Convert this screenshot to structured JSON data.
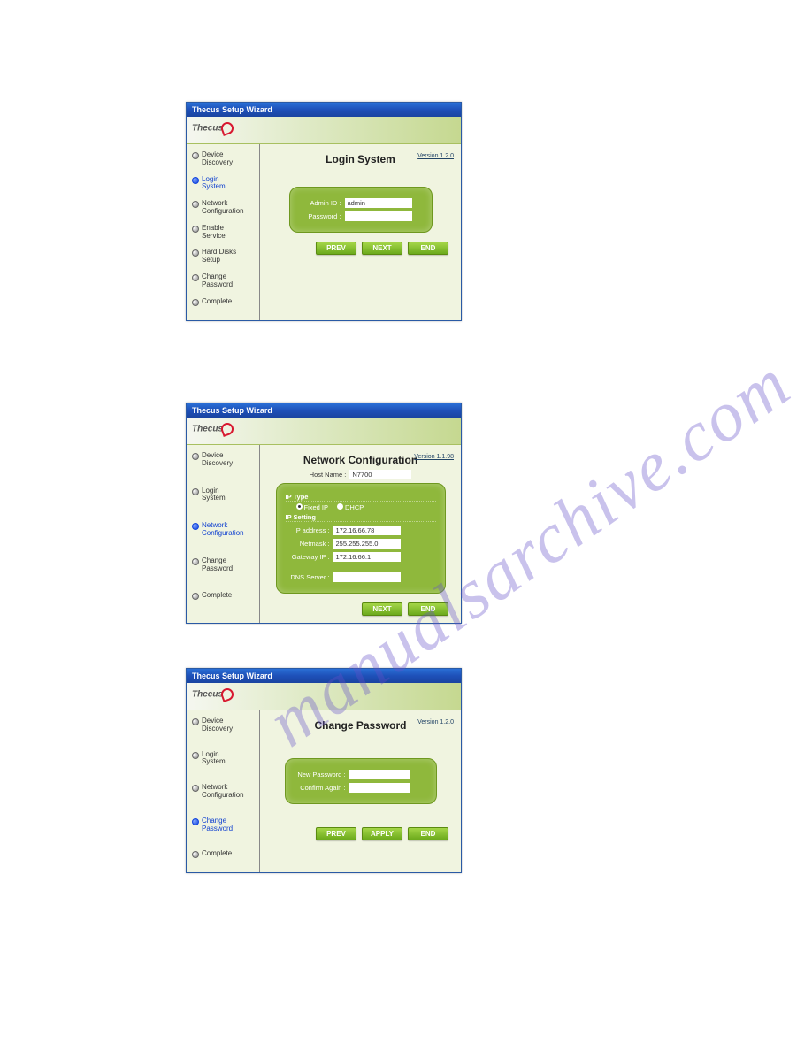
{
  "watermark": "manualsarchive.com",
  "screens": {
    "login": {
      "titlebar": "Thecus Setup Wizard",
      "logo": "Thecus",
      "title": "Login System",
      "version": "Version 1.2.0",
      "sidebar": [
        {
          "label": "Device\nDiscovery",
          "active": false
        },
        {
          "label": "Login\nSystem",
          "active": true
        },
        {
          "label": "Network\nConfiguration",
          "active": false
        },
        {
          "label": "Enable\nService",
          "active": false
        },
        {
          "label": "Hard Disks\nSetup",
          "active": false
        },
        {
          "label": "Change\nPassword",
          "active": false
        },
        {
          "label": "Complete",
          "active": false
        }
      ],
      "fields": {
        "admin_label": "Admin ID :",
        "admin_value": "admin",
        "password_label": "Password :",
        "password_value": ""
      },
      "buttons": {
        "prev": "PREV",
        "next": "NEXT",
        "end": "END"
      }
    },
    "network": {
      "titlebar": "Thecus Setup Wizard",
      "logo": "Thecus",
      "title": "Network Configuration",
      "version": "Version 1.1.98",
      "sidebar": [
        {
          "label": "Device\nDiscovery",
          "active": false
        },
        {
          "label": "Login\nSystem",
          "active": false
        },
        {
          "label": "Network\nConfiguration",
          "active": true
        },
        {
          "label": "Change\nPassword",
          "active": false
        },
        {
          "label": "Complete",
          "active": false
        }
      ],
      "hostname_label": "Host Name :",
      "hostname_value": "N7700",
      "iptype_label": "IP Type",
      "fixed_ip_label": "Fixed IP",
      "dhcp_label": "DHCP",
      "fixed_ip_checked": true,
      "ipsetting_label": "IP Setting",
      "ip_label": "IP address :",
      "ip_value": "172.16.66.78",
      "netmask_label": "Netmask :",
      "netmask_value": "255.255.255.0",
      "gateway_label": "Gateway IP :",
      "gateway_value": "172.16.66.1",
      "dns_label": "DNS Server :",
      "dns_value": "",
      "buttons": {
        "next": "NEXT",
        "end": "END"
      }
    },
    "password": {
      "titlebar": "Thecus Setup Wizard",
      "logo": "Thecus",
      "title": "Change Password",
      "version": "Version 1.2.0",
      "sidebar": [
        {
          "label": "Device\nDiscovery",
          "active": false
        },
        {
          "label": "Login\nSystem",
          "active": false
        },
        {
          "label": "Network\nConfiguration",
          "active": false
        },
        {
          "label": "Change\nPassword",
          "active": true
        },
        {
          "label": "Complete",
          "active": false
        }
      ],
      "fields": {
        "newpw_label": "New Password :",
        "newpw_value": "",
        "confirm_label": "Confirm Again :",
        "confirm_value": ""
      },
      "buttons": {
        "prev": "PREV",
        "apply": "APPLY",
        "end": "END"
      }
    }
  }
}
